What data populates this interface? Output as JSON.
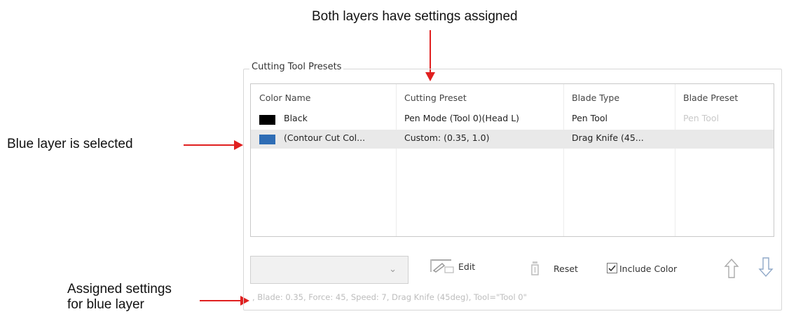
{
  "annotations": {
    "top": "Both layers have settings assigned",
    "left": "Blue layer is selected",
    "bottom_line1": "Assigned settings",
    "bottom_line2": "for blue layer"
  },
  "group_title": "Cutting Tool Presets",
  "columns": [
    "Color Name",
    "Cutting Preset",
    "Blade Type",
    "Blade Preset"
  ],
  "rows": [
    {
      "swatch": "#000000",
      "name": "Black",
      "preset": "Pen Mode (Tool 0)(Head L)",
      "blade": "Pen Tool",
      "blade_preset": "Pen Tool"
    },
    {
      "swatch": "#2f6db5",
      "name": "(Contour Cut Col...",
      "preset": "Custom: (0.35, 1.0)",
      "blade": "Drag Knife (45...",
      "blade_preset": ""
    }
  ],
  "controls": {
    "dropdown_value": "",
    "edit": "Edit",
    "reset": "Reset",
    "include_color": "Include Color",
    "include_color_checked": true
  },
  "status_text": ", Blade: 0.35, Force: 45, Speed: 7, Drag Knife (45deg), Tool=\"Tool 0\"",
  "colors": {
    "arrow": "#e02020",
    "selected_row": "#e9e9e9"
  }
}
